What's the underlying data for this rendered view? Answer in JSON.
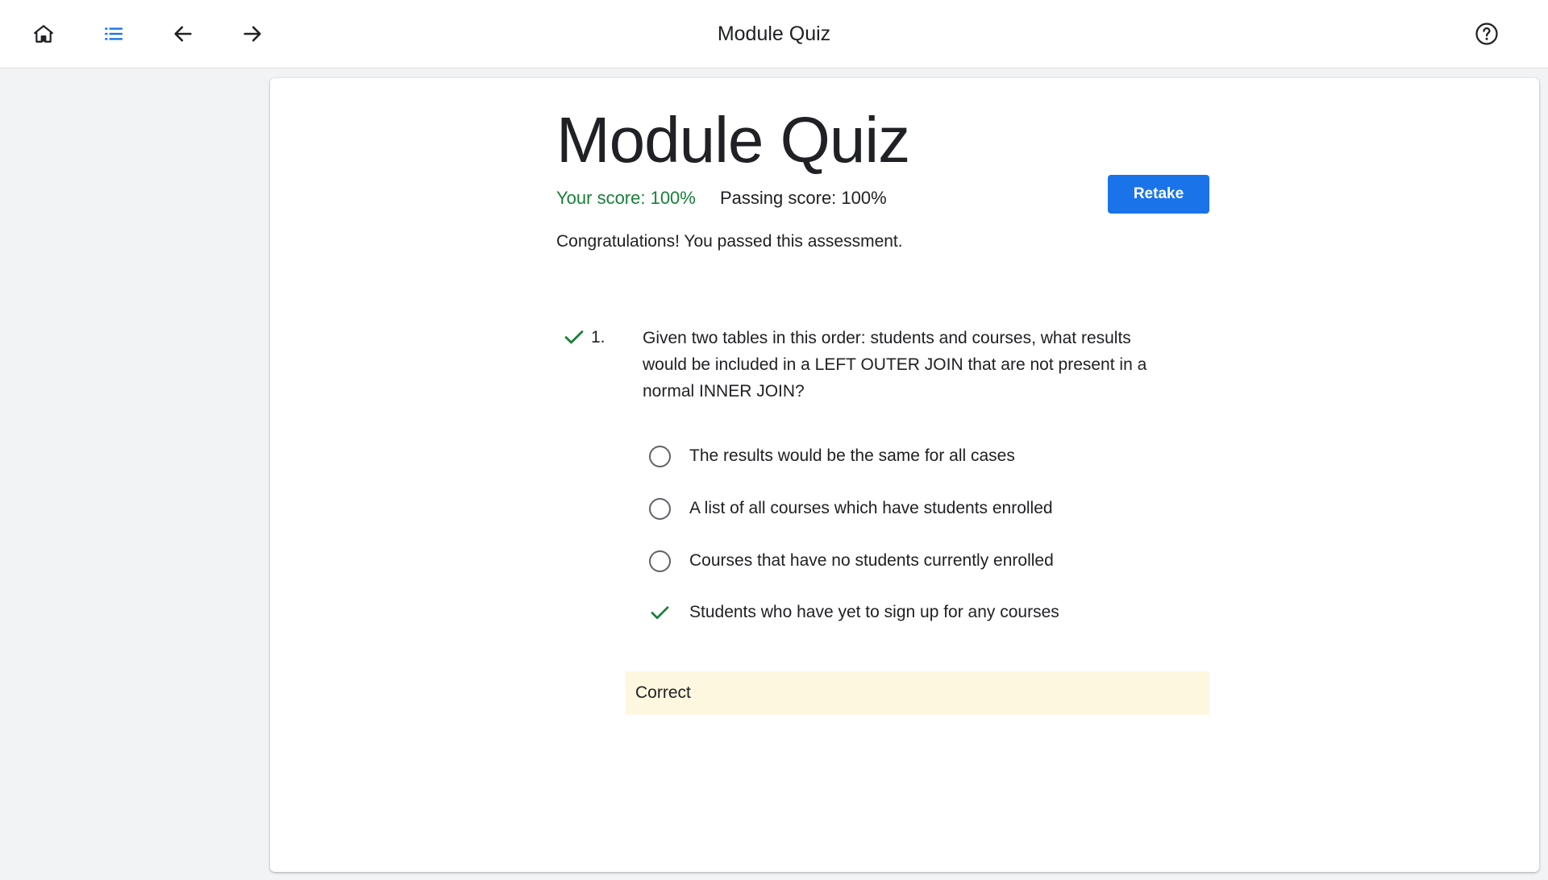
{
  "topbar": {
    "title": "Module Quiz",
    "icons": [
      "home-icon",
      "list-icon",
      "arrow-back-icon",
      "arrow-forward-icon",
      "help-icon"
    ]
  },
  "quiz": {
    "title": "Module Quiz",
    "your_score": "Your score: 100%",
    "passing_score": "Passing score: 100%",
    "retake_label": "Retake",
    "message": "Congratulations! You passed this assessment."
  },
  "question": {
    "number": "1.",
    "text": "Given two tables in this order: students and courses, what results would be included in a LEFT OUTER JOIN that are not present in a normal INNER JOIN?",
    "options": [
      {
        "label": "The results would be the same for all cases",
        "selected": false
      },
      {
        "label": "A list of all courses which have students enrolled",
        "selected": false
      },
      {
        "label": "Courses that have no students currently enrolled",
        "selected": false
      },
      {
        "label": "Students who have yet to sign up for any courses",
        "selected": true
      }
    ],
    "feedback": "Correct"
  },
  "colors": {
    "accent": "#1a73e8",
    "success": "#188038",
    "feedback_bg": "#fef7e0"
  }
}
